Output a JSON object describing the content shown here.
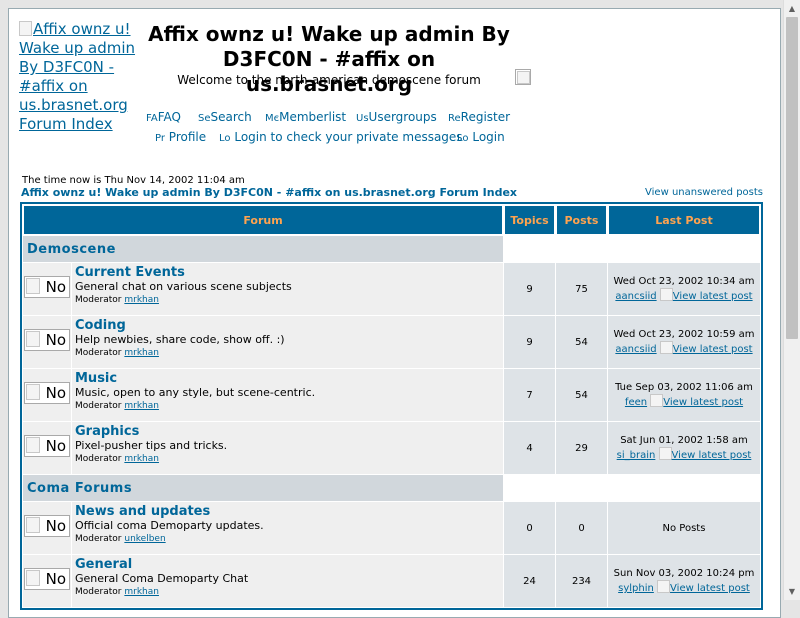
{
  "header": {
    "logo_alt": "Affix ownz u! Wake up admin By D3FC0N - #affix on us.brasnet.org Forum Index",
    "site_title": "Affix ownz u! Wake up admin By D3FC0N - #affix on us.brasnet.org",
    "site_description": "Welcome to the north-american demoscene forum"
  },
  "nav": {
    "faq": {
      "icon_text": "FA",
      "label": "FAQ"
    },
    "search": {
      "icon_text": "Se",
      "label": "Search"
    },
    "memberlist": {
      "icon_text": "Mє",
      "label": "Memberlist"
    },
    "usergroups": {
      "icon_text": "Us",
      "label": "Usergroups"
    },
    "register": {
      "icon_text": "Re",
      "label": "Register"
    },
    "profile": {
      "icon_text": "Pr",
      "label": "Profile"
    },
    "private_messages": {
      "icon_text": "Lo",
      "label": "Login to check your private messages"
    },
    "login": {
      "icon_text": "Lo",
      "label": "Login"
    }
  },
  "time_now": "The time now is Thu Nov 14, 2002 11:04 am",
  "forum_index_link": "Affix ownz u! Wake up admin By D3FC0N - #affix on us.brasnet.org Forum Index",
  "unanswered_link": "View unanswered posts",
  "table": {
    "headers": {
      "forum": "Forum",
      "topics": "Topics",
      "posts": "Posts",
      "last_post": "Last Post"
    }
  },
  "categories": [
    {
      "name": "Demoscene",
      "forums": [
        {
          "icon_alt": "No",
          "name": "Current Events",
          "description": "General chat on various scene subjects",
          "moderator_label": "Moderator",
          "moderator": "mrkhan",
          "topics": "9",
          "posts": "75",
          "last_post_date": "Wed Oct 23, 2002 10:34 am",
          "last_post_user": "aancsiid",
          "last_post_link": "View latest post"
        },
        {
          "icon_alt": "No",
          "name": "Coding",
          "description": "Help newbies, share code, show off. :)",
          "moderator_label": "Moderator",
          "moderator": "mrkhan",
          "topics": "9",
          "posts": "54",
          "last_post_date": "Wed Oct 23, 2002 10:59 am",
          "last_post_user": "aancsiid",
          "last_post_link": "View latest post"
        },
        {
          "icon_alt": "No",
          "name": "Music",
          "description": "Music, open to any style, but scene-centric.",
          "moderator_label": "Moderator",
          "moderator": "mrkhan",
          "topics": "7",
          "posts": "54",
          "last_post_date": "Tue Sep 03, 2002 11:06 am",
          "last_post_user": "feen",
          "last_post_link": "View latest post"
        },
        {
          "icon_alt": "No",
          "name": "Graphics",
          "description": "Pixel-pusher tips and tricks.",
          "moderator_label": "Moderator",
          "moderator": "mrkhan",
          "topics": "4",
          "posts": "29",
          "last_post_date": "Sat Jun 01, 2002 1:58 am",
          "last_post_user": "si_brain",
          "last_post_link": "View latest post"
        }
      ]
    },
    {
      "name": "Coma Forums",
      "forums": [
        {
          "icon_alt": "No",
          "name": "News and updates",
          "description": "Official coma Demoparty updates.",
          "moderator_label": "Moderator",
          "moderator": "unkelben",
          "topics": "0",
          "posts": "0",
          "last_post_date": "No Posts",
          "last_post_user": "",
          "last_post_link": ""
        },
        {
          "icon_alt": "No",
          "name": "General",
          "description": "General Coma Demoparty Chat",
          "moderator_label": "Moderator",
          "moderator": "mrkhan",
          "topics": "24",
          "posts": "234",
          "last_post_date": "Sun Nov 03, 2002 10:24 pm",
          "last_post_user": "sylphin",
          "last_post_link": "View latest post"
        }
      ]
    }
  ]
}
